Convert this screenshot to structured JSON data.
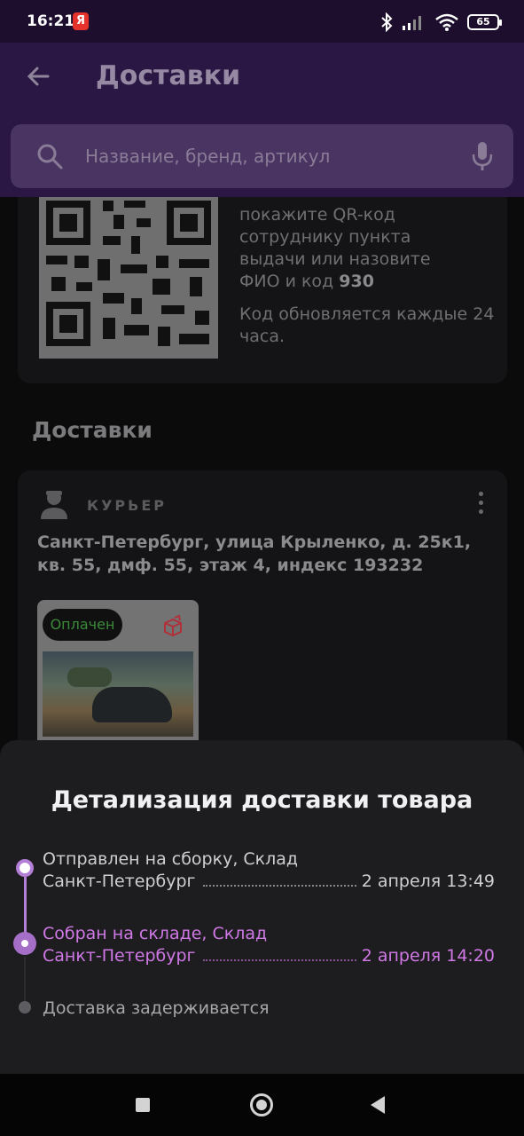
{
  "status_bar": {
    "time": "16:21",
    "yandex_badge": "Я",
    "battery": "65"
  },
  "app_bar": {
    "title": "Доставки",
    "back_icon": "arrow-left-icon"
  },
  "search": {
    "placeholder": "Название, бренд, артикул",
    "icon": "search-icon",
    "mic_icon": "microphone-icon"
  },
  "qr_card": {
    "text_lines": [
      "покажите QR-код",
      "сотруднику пункта",
      "выдачи или назовите"
    ],
    "code_prefix": "ФИО и код",
    "code": "930",
    "note": "Код обновляется каждые 24 часа."
  },
  "section_title": "Доставки",
  "delivery": {
    "type_label": "КУРЬЕР",
    "address": "Санкт-Петербург, улица Крыленко, д. 25к1, кв. 55, дмф. 55, этаж 4, индекс 193232",
    "product": {
      "status": "Оплачен"
    }
  },
  "sheet": {
    "title": "Детализация доставки товара",
    "steps": [
      {
        "line1": "Отправлен на сборку, Склад",
        "line2": "Санкт-Петербург",
        "time": "2 апреля 13:49"
      },
      {
        "line1": "Собран на складе, Склад",
        "line2": "Санкт-Петербург",
        "time": "2 апреля 14:20"
      },
      {
        "line1": "Доставка задерживается"
      }
    ]
  },
  "colors": {
    "accent": "#b37fd6",
    "active_step": "#d079e6",
    "appbar": "#2a1743",
    "sheet": "#1d1c1f"
  }
}
